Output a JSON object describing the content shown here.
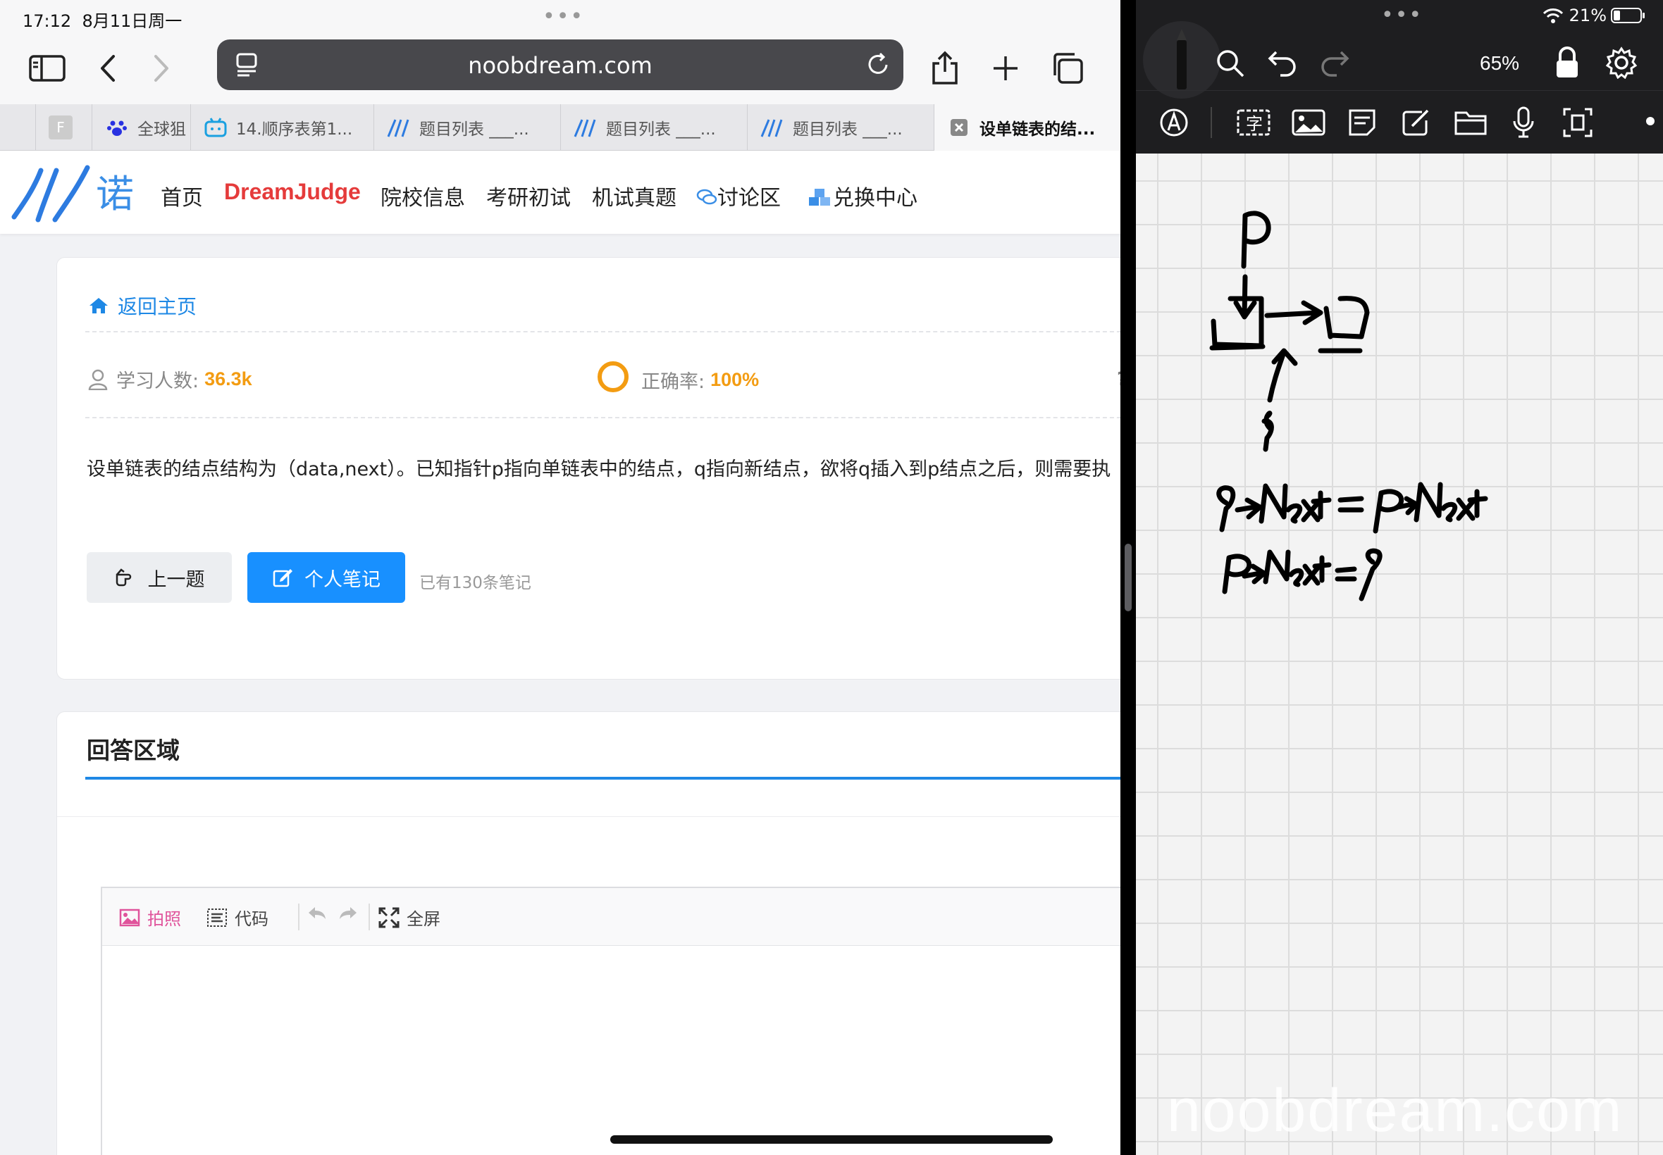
{
  "status": {
    "time": "17:12",
    "date": "8月11日周一",
    "battery": "21%"
  },
  "browser": {
    "url": "noobdream.com",
    "tabs": [
      {
        "label": "F",
        "icon": "favicon-f-icon"
      },
      {
        "label": "全球狙",
        "icon": "baidu-paw-icon"
      },
      {
        "label": "14.顺序表第1...",
        "icon": "bilibili-icon"
      },
      {
        "label": "题目列表 ___...",
        "icon": "noobdream-logo-icon"
      },
      {
        "label": "题目列表 ___...",
        "icon": "noobdream-logo-icon"
      },
      {
        "label": "题目列表 ___...",
        "icon": "noobdream-logo-icon"
      },
      {
        "label": "设单链表的结...",
        "icon": "close-icon"
      }
    ]
  },
  "site": {
    "logo_text": "诺",
    "nav": [
      {
        "label": "首页"
      },
      {
        "label": "DreamJudge"
      },
      {
        "label": "院校信息"
      },
      {
        "label": "考研初试"
      },
      {
        "label": "机试真题"
      },
      {
        "label": "讨论区"
      },
      {
        "label": "兑换中心"
      }
    ]
  },
  "question": {
    "back_label": "返回主页",
    "learners_label": "学习人数:",
    "learners_value": "36.3k",
    "accuracy_label": "正确率:",
    "accuracy_value": "100%",
    "third_label": "未",
    "text": "设单链表的结点结构为（data,next）。已知指针p指向单链表中的结点，q指向新结点，欲将q插入到p结点之后，则需要执",
    "prev_button": "上一题",
    "note_button": "个人笔记",
    "note_count": "已有130条笔记"
  },
  "answer": {
    "title": "回答区域",
    "toolbar": {
      "photo": "拍照",
      "code": "代码",
      "fullscreen": "全屏"
    }
  },
  "notes": {
    "zoom": "65%",
    "handwriting": {
      "label_p": "P",
      "label_q": "q",
      "line1": "q->Next = P->Next",
      "line2": "P->Next = q"
    },
    "watermark": "noobdream.com"
  },
  "colors": {
    "accent": "#1890ff",
    "link": "#1e88e5",
    "brand_red": "#e53b3b",
    "stat_orange": "#f39c12"
  }
}
